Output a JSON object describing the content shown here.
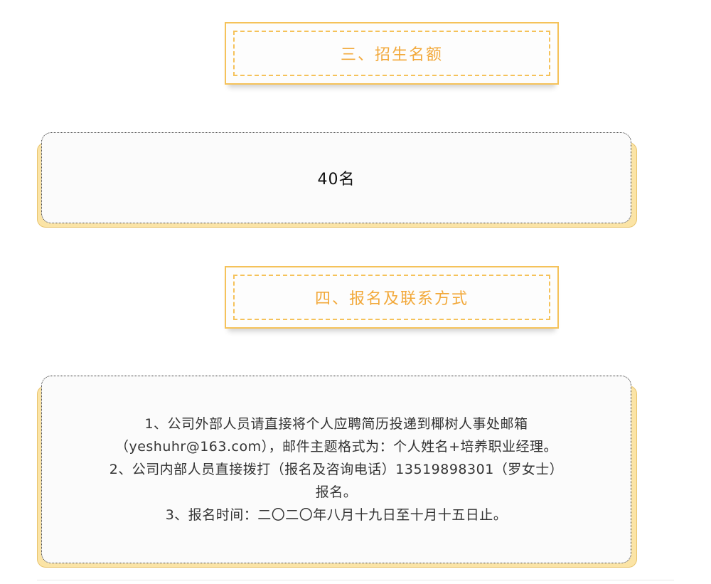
{
  "sections": {
    "quota_title": "三、招生名额",
    "quota_value": "40名",
    "contact_title": "四、报名及联系方式",
    "contact_lines": [
      "1、公司外部人员请直接将个人应聘简历投递到椰树人事处邮箱",
      "（yeshuhr@163.com），邮件主题格式为：个人姓名+培养职业经理。",
      "2、公司内部人员直接拨打（报名及咨询电话）13519898301（罗女士）",
      "报名。",
      "3、报名时间：二〇二〇年八月十九日至十月十五日止。"
    ]
  },
  "colors": {
    "accent": "#f5c25a",
    "title_text": "#f2a93b",
    "card_back": "#fbe4a6"
  }
}
